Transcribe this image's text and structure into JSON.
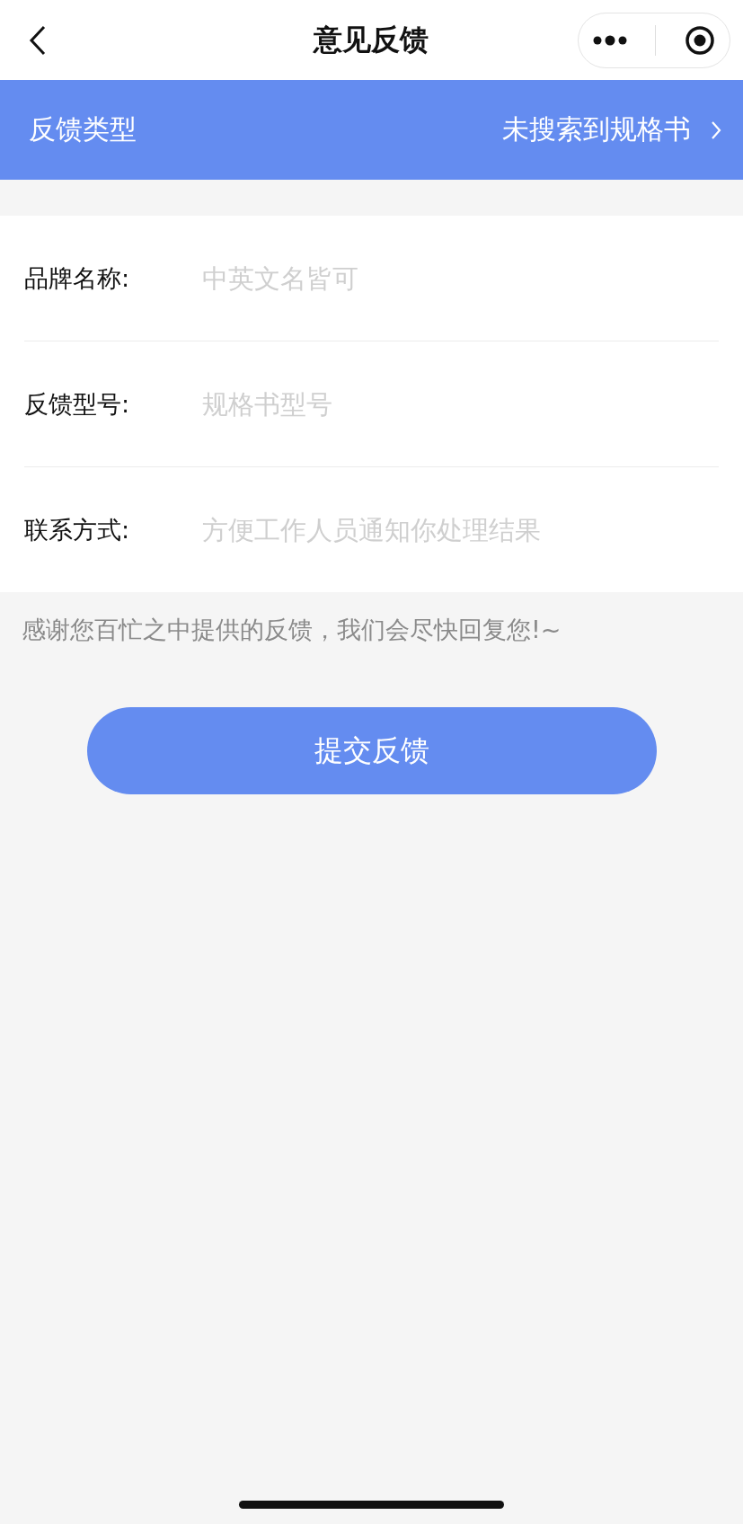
{
  "nav_bar": {
    "title": "意见反馈"
  },
  "type_bar": {
    "label": "反馈类型",
    "value": "未搜索到规格书"
  },
  "fields": [
    {
      "label": "品牌名称:",
      "placeholder": "中英文名皆可"
    },
    {
      "label": "反馈型号:",
      "placeholder": "规格书型号"
    },
    {
      "label": "联系方式:",
      "placeholder": "方便工作人员通知你处理结果"
    }
  ],
  "note": "感谢您百忙之中提供的反馈，我们会尽快回复您!~",
  "submit_button": "提交反馈"
}
